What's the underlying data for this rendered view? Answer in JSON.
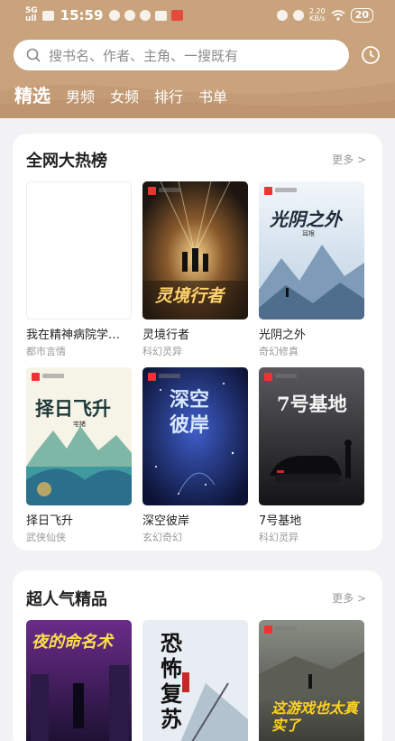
{
  "status_bar": {
    "network": "5G",
    "network_sub": "ull",
    "time": "15:59",
    "speed_value": "2.20",
    "speed_unit": "KB/s",
    "battery": "20"
  },
  "search": {
    "placeholder": "搜书名、作者、主角、一搜既有"
  },
  "tabs": [
    {
      "label": "精选",
      "active": true
    },
    {
      "label": "男频",
      "active": false
    },
    {
      "label": "女频",
      "active": false
    },
    {
      "label": "排行",
      "active": false
    },
    {
      "label": "书单",
      "active": false
    }
  ],
  "sections": [
    {
      "title": "全网大热榜",
      "more": "更多 >",
      "books": [
        {
          "name": "我在精神病院学…",
          "genre": "都市言情",
          "cover_title": ""
        },
        {
          "name": "灵境行者",
          "genre": "科幻灵异",
          "cover_title": "灵境行者"
        },
        {
          "name": "光阴之外",
          "genre": "奇幻修真",
          "cover_title": "光阴之外",
          "cover_author": "耳根"
        },
        {
          "name": "择日飞升",
          "genre": "武侠仙侠",
          "cover_title": "择日飞升",
          "cover_author": "宅猪"
        },
        {
          "name": "深空彼岸",
          "genre": "玄幻奇幻",
          "cover_title": "深空彼岸"
        },
        {
          "name": "7号基地",
          "genre": "科幻灵异",
          "cover_title": "7号基地"
        }
      ]
    },
    {
      "title": "超人气精品",
      "more": "更多 >",
      "books": [
        {
          "cover_title": "夜的命名术"
        },
        {
          "cover_title": "恐怖复苏"
        },
        {
          "cover_title": "这游戏也太真实了"
        }
      ]
    }
  ],
  "colors": {
    "header": "#c9a37c",
    "background": "#f2f1f3",
    "accent_red": "#e33333"
  }
}
